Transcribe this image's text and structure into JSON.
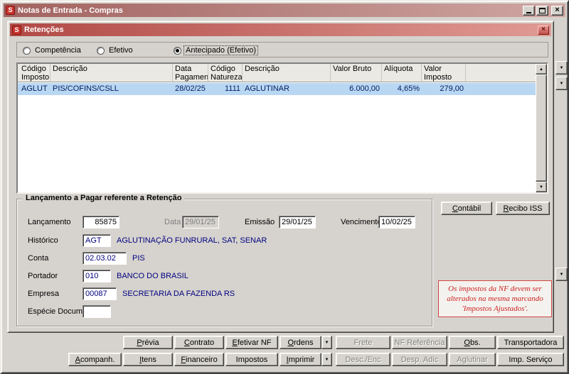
{
  "window": {
    "title": "Notas de Entrada - Compras",
    "logo_letter": "S"
  },
  "icons": {
    "close": "×",
    "dropdown": "▼",
    "scroll_up": "▲",
    "scroll_down": "▼"
  },
  "dialog": {
    "title": "Retenções",
    "logo_letter": "S",
    "radios": {
      "competencia": "Competência",
      "efetivo": "Efetivo",
      "antecipado": "Antecipado (Efetivo)"
    },
    "grid": {
      "headers": [
        "Código\nImposto",
        "Descrição",
        "Data\nPagamento",
        "Código\nNatureza",
        "Descrição",
        "Valor Bruto",
        "Alíquota",
        "Valor Imposto"
      ],
      "row": [
        "AGLUT",
        "PIS/COFINS/CSLL",
        "28/02/25",
        "1111",
        "AGLUTINAR",
        "6.000,00",
        "4,65%",
        "279,00"
      ]
    },
    "groupbox": {
      "title": "Lançamento a Pagar referente a Retenção",
      "lancamento_label": "Lançamento",
      "lancamento_value": "85875",
      "data_label": "Data",
      "data_value": "29/01/25",
      "emissao_label": "Emissão",
      "emissao_value": "29/01/25",
      "vencimento_label": "Vencimento",
      "vencimento_value": "10/02/25",
      "historico_label": "Histórico",
      "historico_code": "AGT",
      "historico_desc": "AGLUTINAÇÃO FUNRURAL, SAT, SENAR",
      "conta_label": "Conta",
      "conta_code": "02.03.02",
      "conta_desc": "PIS",
      "portador_label": "Portador",
      "portador_code": "010",
      "portador_desc": "BANCO DO BRASIL",
      "empresa_label": "Empresa",
      "empresa_code": "00087",
      "empresa_desc": "SECRETARIA DA FAZENDA RS",
      "especie_label": "Espécie Documento",
      "especie_value": ""
    },
    "contabil_button": "Contábil",
    "recibo_iss_button": "Recibo ISS",
    "note": "Os impostos da NF devem ser alterados na mesma marcando 'Impostos Ajustados'."
  },
  "bottom": {
    "row1": [
      "Prévia",
      "Contrato",
      "Efetivar NF",
      "Ordens",
      "Frete",
      "NF Referência",
      "Obs.",
      "Transportadora"
    ],
    "row2": [
      "Acompanh.",
      "Itens",
      "Financeiro",
      "Impostos",
      "Imprimir",
      "Desc./Enc",
      "Desp. Adic",
      "Aglutinar",
      "Imp. Serviço"
    ]
  }
}
